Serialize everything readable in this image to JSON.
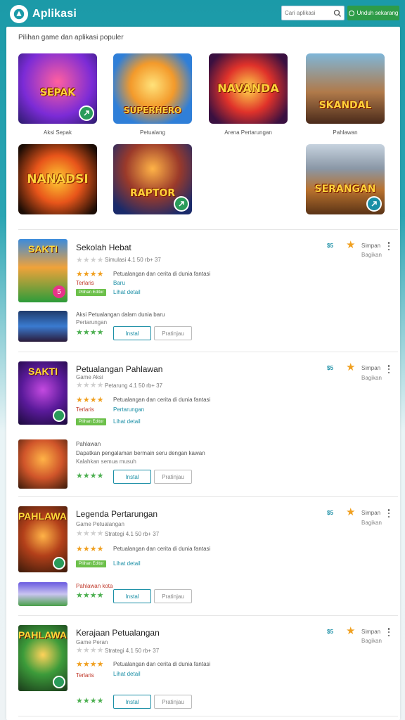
{
  "header": {
    "brand": "Aplikasi",
    "search_placeholder": "Cari aplikasi",
    "action_button": "Unduh sekarang",
    "brand_color": "#1b9aa8",
    "accent_green": "#2e9c48"
  },
  "featured": {
    "title": "Pilihan game dan aplikasi populer",
    "tiles": [
      {
        "caption": "Aksi Sepak",
        "art_text": "SEPAK",
        "icon": "game-art"
      },
      {
        "caption": "Petualang",
        "art_text": "SUPERHERO",
        "icon": "game-art"
      },
      {
        "caption": "Arena Pertarungan",
        "art_text": "NAVANDA",
        "icon": "game-art"
      },
      {
        "caption": "Pahlawan",
        "art_text": "SKANDAL",
        "icon": "game-art"
      },
      {
        "caption": "",
        "art_text": "NANADSI",
        "icon": "game-art"
      },
      {
        "caption": "",
        "art_text": "RAPTOR",
        "icon": "game-art"
      },
      {
        "caption": "",
        "art_text": "SERANGAN",
        "icon": "game-art"
      }
    ]
  },
  "apps": [
    {
      "name": "Sekolah Hebat",
      "meta": "Simulasi  4.1  50 rb+ 37",
      "stars": 4,
      "desc": "Petualangan dan cerita di dunia fantasi",
      "tagline": "Terlaris",
      "sub_link": "Baru",
      "green_tag": "Pilihan Editor",
      "link": "Lihat detail",
      "extra_title": "Aksi Petualangan dalam dunia baru",
      "extra_sub": "Pertarungan",
      "primary_btn": "Instal",
      "secondary_btn": "Pratinjau",
      "price": "$5",
      "side_top": "Simpan",
      "side_bot": "Bagikan",
      "art_text": "SAKTI"
    },
    {
      "name": "Petualangan Pahlawan",
      "meta": "Game Aksi",
      "meta2": "Petarung  4.1  50 rb+ 37",
      "stars": 4,
      "desc": "Petualangan dan cerita di dunia fantasi",
      "tagline": "Terlaris",
      "sub_link": "Pertarungan",
      "green_tag": "Pilihan Editor",
      "link": "Lihat detail",
      "extra_title": "Pahlawan",
      "extra_sub": "Dapatkan pengalaman bermain seru dengan kawan",
      "extra_sub2": "Kalahkan semua musuh",
      "primary_btn": "Instal",
      "secondary_btn": "Pratinjau",
      "price": "$5",
      "side_top": "Simpan",
      "side_bot": "Bagikan",
      "art_text": "SAKTI"
    },
    {
      "name": "Legenda Pertarungan",
      "meta": "Game Petualangan",
      "meta2": "Strategi  4.1  50 rb+ 37",
      "stars": 4,
      "desc": "Petualangan dan cerita di dunia fantasi",
      "green_tag": "Pilihan Editor",
      "link": "Lihat detail",
      "extra_sub": "Pahlawan kota",
      "primary_btn": "Instal",
      "secondary_btn": "Pratinjau",
      "price": "$5",
      "side_top": "Simpan",
      "side_bot": "Bagikan",
      "art_text": "PAHLAWAN"
    },
    {
      "name": "Kerajaan Petualangan",
      "meta": "Game Peran",
      "meta2": "Strategi  4.1  50 rb+ 37",
      "stars": 4,
      "desc": "Petualangan dan cerita di dunia fantasi",
      "tagline": "Terlaris",
      "link": "Lihat detail",
      "primary_btn": "Instal",
      "secondary_btn": "Pratinjau",
      "price": "$5",
      "side_top": "Simpan",
      "side_bot": "Bagikan",
      "art_text": "PAHLAWAN"
    }
  ]
}
